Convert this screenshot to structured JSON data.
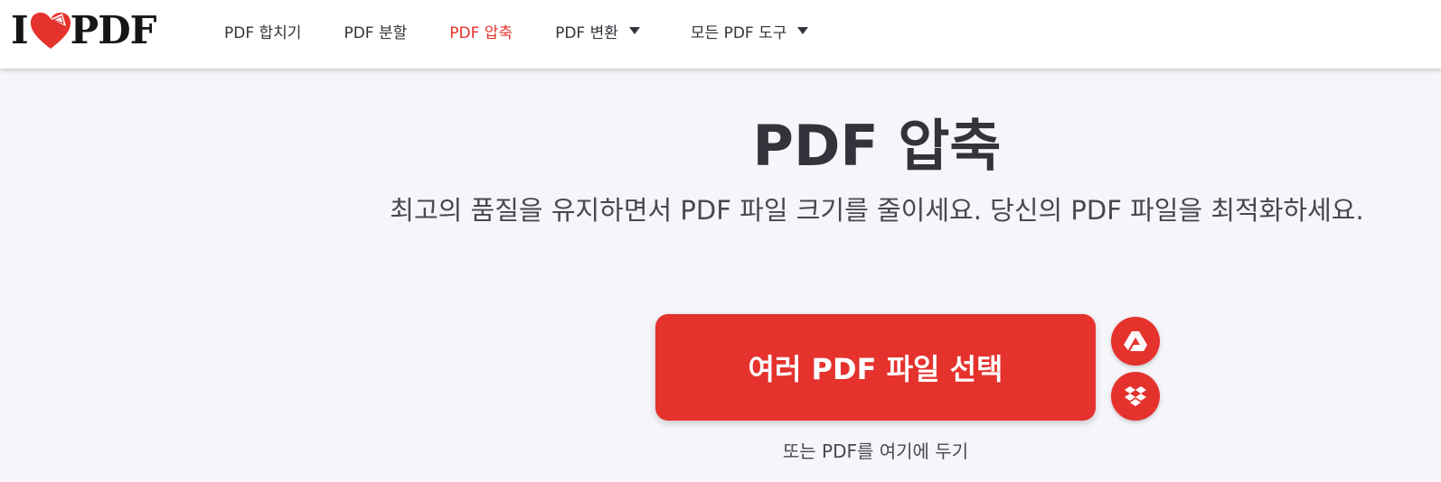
{
  "brand": {
    "logo_prefix": "I",
    "logo_suffix": "PDF",
    "accent_color": "#e5322d"
  },
  "nav": {
    "items": [
      {
        "label": "PDF 합치기",
        "active": false,
        "dropdown": false
      },
      {
        "label": "PDF 분할",
        "active": false,
        "dropdown": false
      },
      {
        "label": "PDF 압축",
        "active": true,
        "dropdown": false
      },
      {
        "label": "PDF 변환",
        "active": false,
        "dropdown": true
      },
      {
        "label": "모든 PDF 도구",
        "active": false,
        "dropdown": true
      }
    ]
  },
  "main": {
    "title": "PDF 압축",
    "subtitle": "최고의 품질을 유지하면서 PDF 파일 크기를 줄이세요. 당신의 PDF 파일을 최적화하세요.",
    "select_button": "여러 PDF 파일 선택",
    "drop_hint": "또는 PDF를 여기에 두기",
    "cloud_buttons": [
      {
        "icon": "google-drive-icon"
      },
      {
        "icon": "dropbox-icon"
      }
    ]
  }
}
